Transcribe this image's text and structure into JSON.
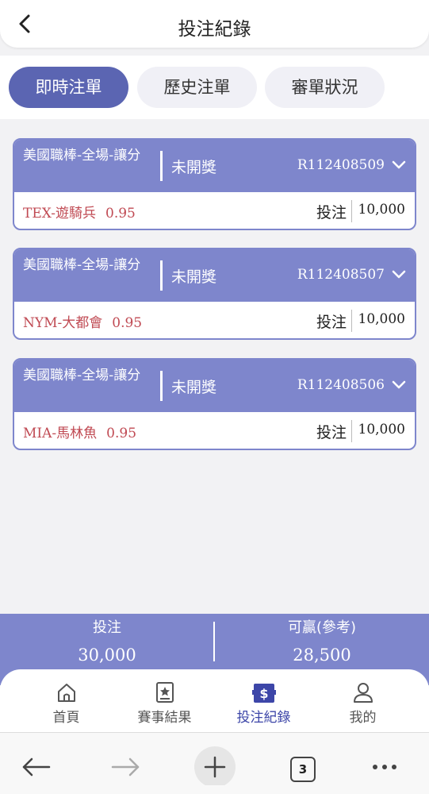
{
  "header": {
    "title": "投注紀錄"
  },
  "tabs": [
    {
      "label": "即時注單",
      "active": true
    },
    {
      "label": "歷史注單",
      "active": false
    },
    {
      "label": "審單狀況",
      "active": false
    }
  ],
  "bets": [
    {
      "league": "美國職棒-全場-讓分",
      "status": "未開獎",
      "order_no": "R112408509",
      "selection": "TEX-遊騎兵",
      "odds": "0.95",
      "bet_label": "投注",
      "amount": "10,000"
    },
    {
      "league": "美國職棒-全場-讓分",
      "status": "未開獎",
      "order_no": "R112408507",
      "selection": "NYM-大都會",
      "odds": "0.95",
      "bet_label": "投注",
      "amount": "10,000"
    },
    {
      "league": "美國職棒-全場-讓分",
      "status": "未開獎",
      "order_no": "R112408506",
      "selection": "MIA-馬林魚",
      "odds": "0.95",
      "bet_label": "投注",
      "amount": "10,000"
    }
  ],
  "summary": {
    "bet_label": "投注",
    "bet_value": "30,000",
    "win_label": "可贏(參考)",
    "win_value": "28,500"
  },
  "nav": [
    {
      "label": "首頁",
      "icon": "home-icon",
      "active": false
    },
    {
      "label": "賽事結果",
      "icon": "results-icon",
      "active": false
    },
    {
      "label": "投注紀錄",
      "icon": "bet-record-icon",
      "active": true
    },
    {
      "label": "我的",
      "icon": "user-icon",
      "active": false
    }
  ],
  "browser": {
    "tab_count": "3"
  },
  "colors": {
    "accent": "#5b65b2",
    "card_header": "#7e86cc",
    "selection_text": "#c04a53",
    "nav_active": "#3d46a8"
  }
}
